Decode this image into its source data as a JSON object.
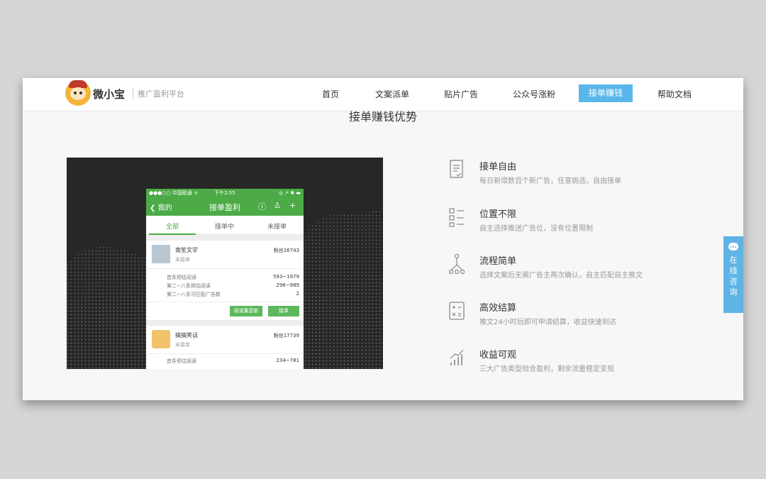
{
  "brand": {
    "name": "微小宝",
    "subtitle": "推广盈利平台"
  },
  "nav": {
    "items": [
      {
        "label": "首页",
        "active": false
      },
      {
        "label": "文案派单",
        "active": false
      },
      {
        "label": "贴片广告",
        "active": false
      },
      {
        "label": "公众号涨粉",
        "active": false
      },
      {
        "label": "接单赚钱",
        "active": true
      },
      {
        "label": "帮助文档",
        "active": false
      }
    ],
    "active_color": "#58b6ea"
  },
  "section": {
    "title": "接单赚钱优势"
  },
  "phone": {
    "status": {
      "carrier": "●●●○○ 中国联通 ᯤ",
      "time": "下午2:55",
      "right": "◎ ↗ ✱ ▬"
    },
    "header": {
      "back": "我的",
      "title": "接单盈利"
    },
    "tabs": [
      "全部",
      "接单中",
      "未接单"
    ],
    "cards": [
      {
        "name": "南笙文学",
        "status": "未接单",
        "fans": "粉丝16743",
        "rows": [
          {
            "label": "首条预估阅读",
            "value": "593~1979"
          },
          {
            "label": "第二~八条预估阅读",
            "value": "296~989"
          },
          {
            "label": "第二~八条可匹配广告数",
            "value": "2"
          }
        ],
        "buttons": [
          "阅读量更新",
          "接单"
        ]
      },
      {
        "name": "搞搞笑话",
        "status": "未接单",
        "fans": "粉丝17739",
        "rows": [
          {
            "label": "首条预估阅读",
            "value": "234~781"
          }
        ]
      }
    ],
    "accent": "#4caa47"
  },
  "features": [
    {
      "icon": "document-icon",
      "title": "接单自由",
      "desc": "每日新增数百个新广告，任意挑选，自由接单"
    },
    {
      "icon": "grid-list-icon",
      "title": "位置不限",
      "desc": "自主选择推送广告位，没有位置限制"
    },
    {
      "icon": "flow-tree-icon",
      "title": "流程简单",
      "desc": "选择文案后无需广告主再次确认，自主匹配自主推文"
    },
    {
      "icon": "calculator-icon",
      "title": "高效结算",
      "desc": "推文24小时后即可申请结算，收益快速到达"
    },
    {
      "icon": "bar-chart-icon",
      "title": "收益可观",
      "desc": "三大广告类型组合盈利，剩余流量稳定变现"
    }
  ],
  "consult": {
    "label": "在线咨询"
  }
}
